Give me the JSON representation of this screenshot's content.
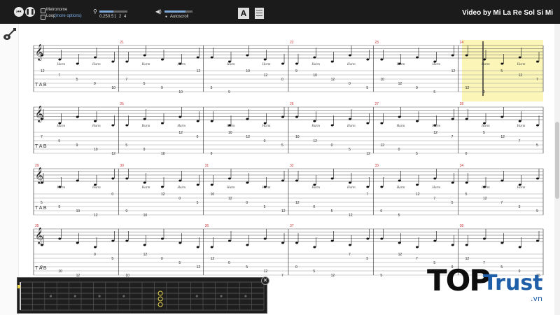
{
  "toolbar": {
    "prev_icon": "rewind-icon",
    "pause_icon": "pause-icon",
    "metronome_label": "Metronome",
    "loop_label": "Loop",
    "loop_options": "(more options)",
    "speed_values": [
      "0.25",
      "0.5",
      "1",
      "2",
      "4"
    ],
    "autoscroll_label": "Autoscroll",
    "font_button": "A",
    "video_title": "Video by Mi La Re Sol Si Mi"
  },
  "colors": {
    "highlight": "#fbf6b7",
    "toolbar_bg": "#1b1b1b",
    "logo_blue": "#1f5ea8"
  },
  "score": {
    "systems": [
      {
        "measures": [
          "",
          "21",
          "",
          "22",
          "23",
          "24"
        ],
        "harm_count": 18
      },
      {
        "measures": [
          "",
          "25",
          "",
          "26",
          "27",
          "28"
        ],
        "harm_count": 12
      },
      {
        "measures": [
          "29",
          "30",
          "31",
          "32",
          "33",
          "34"
        ],
        "harm_count": 14
      },
      {
        "measures": [
          "35",
          "",
          "36",
          "37",
          "",
          "38"
        ],
        "harm_count": 0
      }
    ],
    "harm_label": "Harm"
  },
  "logo": {
    "top": "TOP",
    "trust": "Trust",
    "vn": ".vn"
  }
}
